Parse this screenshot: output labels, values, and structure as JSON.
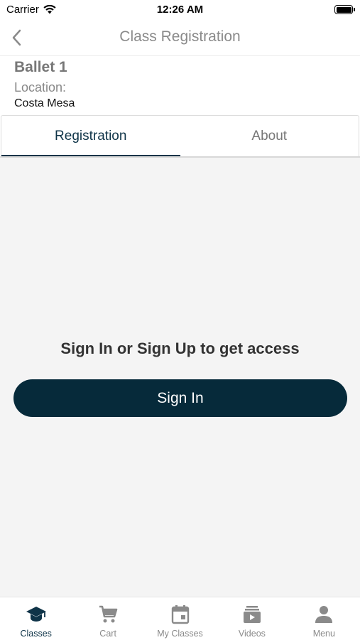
{
  "status_bar": {
    "carrier": "Carrier",
    "time": "12:26 AM"
  },
  "nav": {
    "title": "Class Registration",
    "back_icon": "chevron-left-icon"
  },
  "class_info": {
    "name": "Ballet 1",
    "location_label": "Location:",
    "location_value": "Costa Mesa"
  },
  "tabs": [
    {
      "label": "Registration",
      "active": true
    },
    {
      "label": "About",
      "active": false
    }
  ],
  "main": {
    "prompt": "Sign In or Sign Up to get access",
    "sign_in_label": "Sign In"
  },
  "tabbar": {
    "items": [
      {
        "label": "Classes",
        "icon": "graduation-cap-icon",
        "active": true
      },
      {
        "label": "Cart",
        "icon": "cart-icon",
        "active": false
      },
      {
        "label": "My Classes",
        "icon": "calendar-icon",
        "active": false
      },
      {
        "label": "Videos",
        "icon": "video-library-icon",
        "active": false
      },
      {
        "label": "Menu",
        "icon": "person-icon",
        "active": false
      }
    ]
  },
  "colors": {
    "primary": "#062a3a",
    "accent": "#0f3448",
    "inactive": "#8a8a8a",
    "background": "#f4f4f4"
  }
}
